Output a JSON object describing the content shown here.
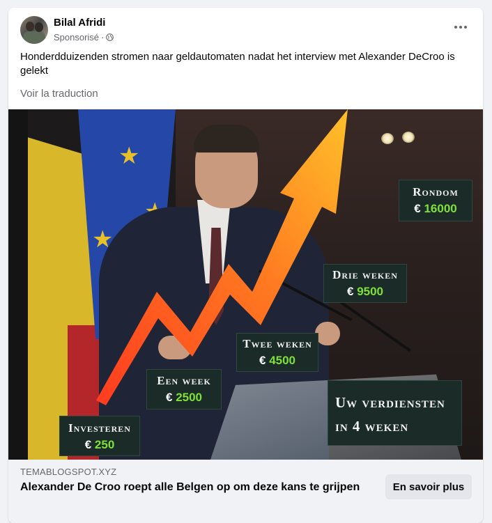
{
  "post": {
    "author": "Bilal Afridi",
    "sponsored_label": "Sponsorisé",
    "separator": " · ",
    "icons": {
      "privacy": "globe-icon",
      "menu": "more-options-icon"
    },
    "text": "Honderdduizenden stromen naar geldautomaten nadat het interview met Alexander DeCroo is gelekt",
    "translate_link": "Voir la traduction"
  },
  "image_overlay": {
    "labels": [
      {
        "title": "Investeren",
        "prefix": "€",
        "amount": "250"
      },
      {
        "title": "Een week",
        "prefix": "€",
        "amount": "2500"
      },
      {
        "title": "Twee weken",
        "prefix": "€",
        "amount": "4500"
      },
      {
        "title": "Drie weken",
        "prefix": "€",
        "amount": "9500"
      },
      {
        "title": "Rondom",
        "prefix": "€",
        "amount": "16000"
      }
    ],
    "summary_line1": "Uw verdiensten",
    "summary_line2": "in 4 weken",
    "colors": {
      "arrow_start": "#ff3b1f",
      "arrow_end": "#ffc02a",
      "amount": "#7fe03a",
      "label_bg": "#1b2b28"
    }
  },
  "link": {
    "domain": "TEMABLOGSPOT.XYZ",
    "title": "Alexander De Croo roept alle Belgen op om deze kans te grijpen",
    "cta_label": "En savoir plus"
  }
}
